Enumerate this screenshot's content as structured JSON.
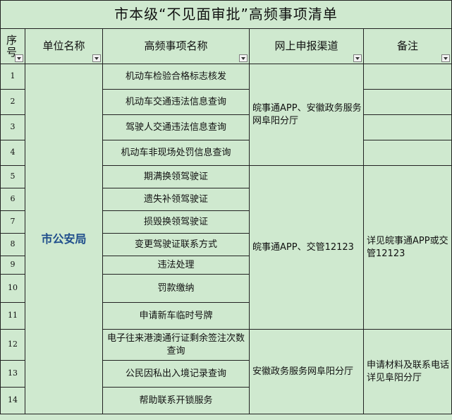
{
  "title": "市本级“不见面审批”高频事项清单",
  "headers": {
    "seq": "序号",
    "unit": "单位名称",
    "item": "高频事项名称",
    "channel": "网上申报渠道",
    "note": "备注"
  },
  "unit_name": "市公安局",
  "rows": [
    {
      "no": "1",
      "item": "机动车检验合格标志核发"
    },
    {
      "no": "2",
      "item": "机动车交通违法信息查询"
    },
    {
      "no": "3",
      "item": "驾驶人交通违法信息查询"
    },
    {
      "no": "4",
      "item": "机动车非现场处罚信息查询"
    },
    {
      "no": "5",
      "item": "期满换领驾驶证"
    },
    {
      "no": "6",
      "item": "遗失补领驾驶证"
    },
    {
      "no": "7",
      "item": "损毁换领驾驶证"
    },
    {
      "no": "8",
      "item": "变更驾驶证联系方式"
    },
    {
      "no": "9",
      "item": "违法处理"
    },
    {
      "no": "10",
      "item": "罚款缴纳"
    },
    {
      "no": "11",
      "item": "申请新车临时号牌"
    },
    {
      "no": "12",
      "item": "电子往来港澳通行证剩余签注次数查询"
    },
    {
      "no": "13",
      "item": "公民因私出入境记录查询"
    },
    {
      "no": "14",
      "item": "帮助联系开锁服务"
    }
  ],
  "channels": [
    "皖事通APP、安徽政务服务网阜阳分厅",
    "皖事通APP、交管12123",
    "安徽政务服务网阜阳分厅"
  ],
  "notes": [
    "详见皖事通APP或交管12123",
    "申请材料及联系电话详见阜阳分厅"
  ]
}
